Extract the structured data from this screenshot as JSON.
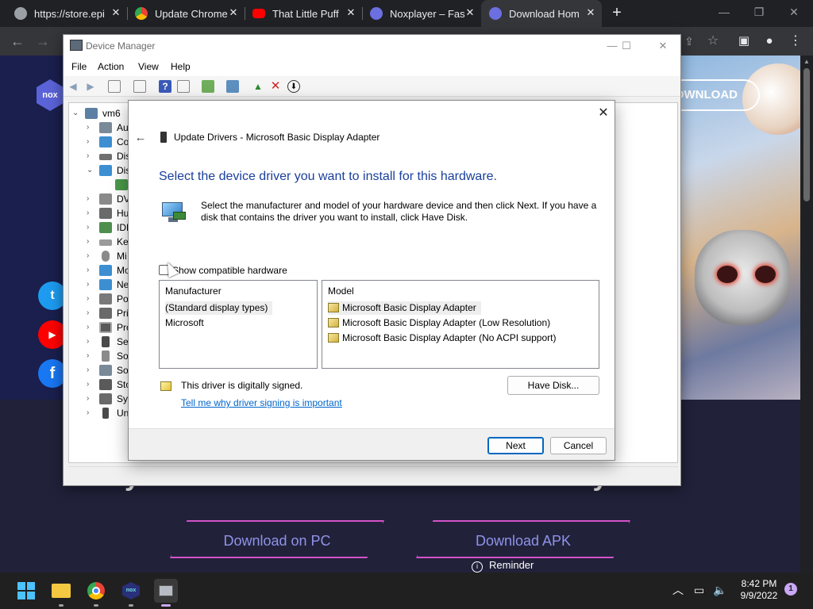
{
  "browser": {
    "tabs": [
      {
        "title": "https://store.epi",
        "favicon_color": "#9aa0a6",
        "active": false
      },
      {
        "title": "Update Chrome",
        "favicon_color": "#34a853",
        "active": false
      },
      {
        "title": "That Little Puff",
        "favicon_color": "#ff0000",
        "active": false
      },
      {
        "title": "Noxplayer – Fas",
        "favicon_color": "#6b6fe0",
        "active": false
      },
      {
        "title": "Download Hom",
        "favicon_color": "#6b6fe0",
        "active": true
      }
    ],
    "tab_close_glyph": "✕",
    "new_tab_glyph": "+"
  },
  "website": {
    "header_button": "DOWNLOAD",
    "logo": "nox",
    "headline": "Play Homerun Clash on PC with NoxPlayer",
    "download_pc": "Download on PC",
    "download_apk": "Download APK",
    "reminder": "Reminder"
  },
  "device_manager": {
    "title": "Device Manager",
    "menu": [
      "File",
      "Action",
      "View",
      "Help"
    ],
    "tree_root": "vm6",
    "tree_items": [
      "Au",
      "Co",
      "Dis",
      "Dis",
      "DV",
      "Hu",
      "IDE",
      "Key",
      "Mi",
      "Mo",
      "Ne",
      "Po",
      "Pri",
      "Pro",
      "Sec",
      "Sof",
      "Sou",
      "Sto",
      "Sys",
      "Un"
    ]
  },
  "update_drivers": {
    "title": "Update Drivers - Microsoft Basic Display Adapter",
    "heading": "Select the device driver you want to install for this hardware.",
    "description": "Select the manufacturer and model of your hardware device and then click Next. If you have a disk that contains the driver you want to install, click Have Disk.",
    "show_compatible_label": "Show compatible hardware",
    "show_compatible_checked": false,
    "manufacturer_header": "Manufacturer",
    "manufacturers": [
      "(Standard display types)",
      "Microsoft"
    ],
    "selected_manufacturer": "(Standard display types)",
    "model_header": "Model",
    "models": [
      "Microsoft Basic Display Adapter",
      "Microsoft Basic Display Adapter (Low Resolution)",
      "Microsoft Basic Display Adapter (No ACPI support)"
    ],
    "selected_model": "Microsoft Basic Display Adapter",
    "signed_text": "This driver is digitally signed.",
    "signing_link": "Tell me why driver signing is important",
    "have_disk": "Have Disk...",
    "next": "Next",
    "cancel": "Cancel"
  },
  "taskbar": {
    "time": "8:42 PM",
    "date": "9/9/2022",
    "notification_count": "1"
  }
}
